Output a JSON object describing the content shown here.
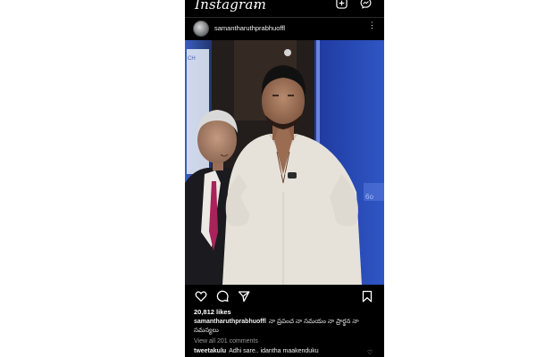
{
  "app": {
    "logo": "Instagram",
    "chevron": "⌄",
    "icons": [
      "add-icon",
      "messenger-icon"
    ]
  },
  "post": {
    "username": "samantharuthprabhuoffl",
    "more_icon": "⋮",
    "likes": "20,812 likes",
    "caption_user": "samantharuthprabhuoffl",
    "caption_text": "నా ప్రపంచ నా సమయం నా ప్రార్థన నా సమస్యలు",
    "view_comments": "View all 201 comments",
    "comment_user": "tweetakulu",
    "comment_text": "Adhi sare.. idantha maakenduku",
    "comment_heart": "♡",
    "action_icons": [
      "heart-icon",
      "comment-icon",
      "share-icon",
      "bookmark-icon"
    ]
  },
  "colors": {
    "background": "#000000",
    "text": "#ffffff",
    "muted": "#9a9a9a",
    "stage_blue": "#2f56b8"
  }
}
